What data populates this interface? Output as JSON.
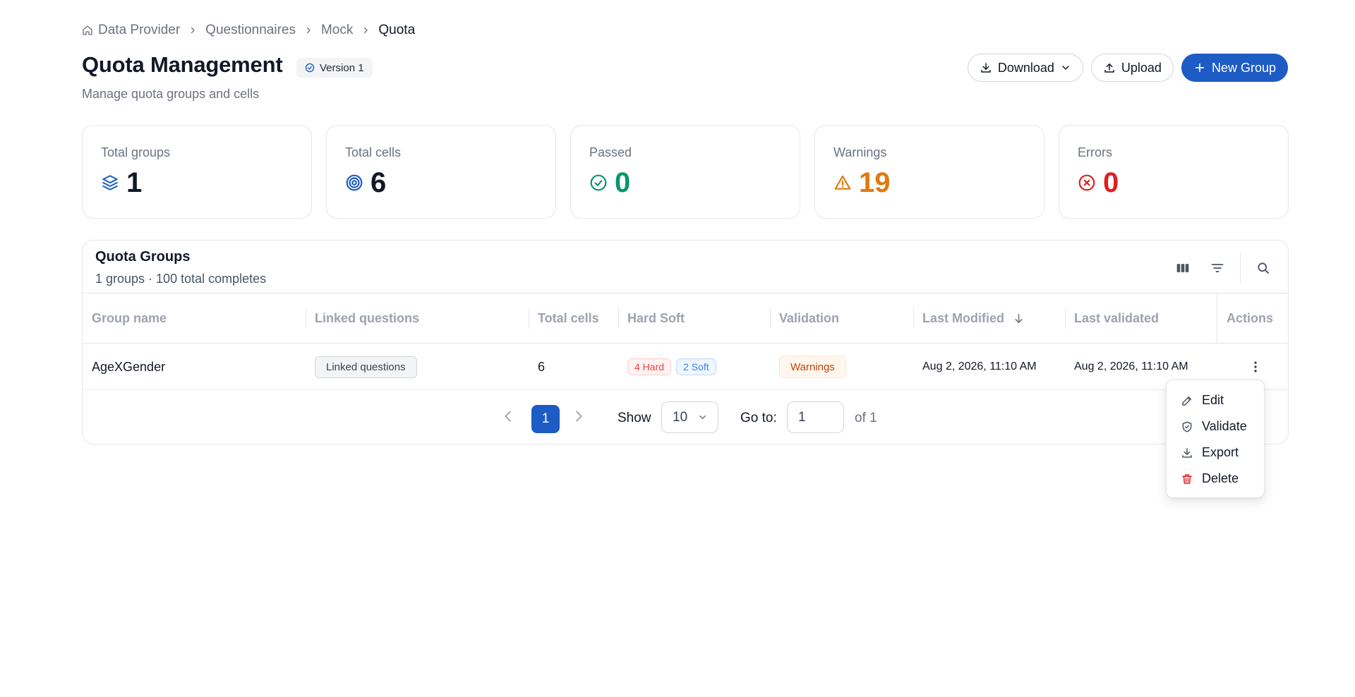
{
  "breadcrumb": {
    "items": [
      "Data Provider",
      "Questionnaires",
      "Mock"
    ],
    "current": "Quota"
  },
  "header": {
    "title": "Quota Management",
    "version": "Version 1",
    "subtitle": "Manage quota groups and cells",
    "download_label": "Download",
    "upload_label": "Upload",
    "new_group_label": "New Group"
  },
  "stats": [
    {
      "label": "Total groups",
      "value": "1",
      "icon": "layers-icon",
      "color": "#111827"
    },
    {
      "label": "Total cells",
      "value": "6",
      "icon": "target-icon",
      "color": "#111827"
    },
    {
      "label": "Passed",
      "value": "0",
      "icon": "check-circle-icon",
      "color": "#059669"
    },
    {
      "label": "Warnings",
      "value": "19",
      "icon": "warning-triangle-icon",
      "color": "#e07a0e"
    },
    {
      "label": "Errors",
      "value": "0",
      "icon": "x-circle-icon",
      "color": "#e11d1d"
    }
  ],
  "table": {
    "title": "Quota Groups",
    "subtitle": "1 groups · 100 total completes",
    "columns": [
      "Group name",
      "Linked questions",
      "Total cells",
      "Hard Soft",
      "Validation",
      "Last Modified",
      "Last validated",
      "Actions"
    ],
    "rows": [
      {
        "group_name": "AgeXGender",
        "linked_questions": "Linked questions",
        "total_cells": "6",
        "hard": "4 Hard",
        "soft": "2 Soft",
        "validation": "Warnings",
        "last_modified": "Aug 2, 2026, 11:10 AM",
        "last_validated": "Aug 2, 2026, 11:10 AM"
      }
    ]
  },
  "pagination": {
    "current_page": "1",
    "show_label": "Show",
    "page_size": "10",
    "goto_label": "Go to:",
    "goto_value": "1",
    "of_label": "of 1"
  },
  "menu": {
    "items": [
      "Edit",
      "Validate",
      "Export",
      "Delete"
    ]
  },
  "colors": {
    "primary": "#1d5bc5",
    "danger": "#e11d1d"
  }
}
